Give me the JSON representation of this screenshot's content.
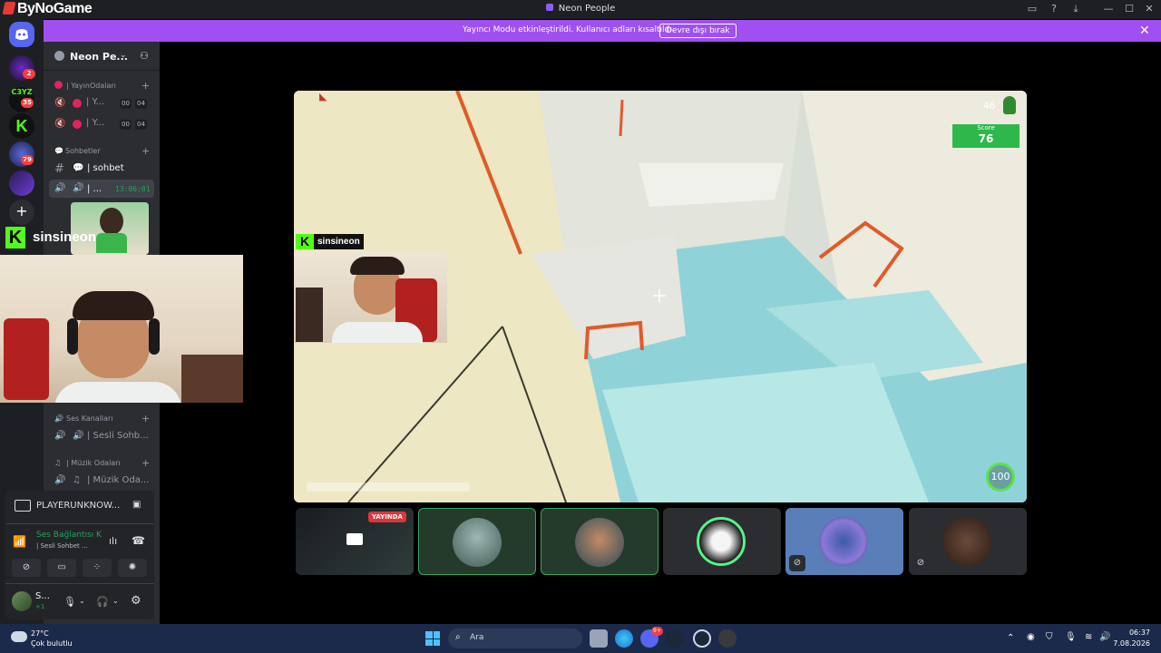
{
  "app": {
    "brand": "ByNoGame",
    "window_title": "Neon People"
  },
  "banner": {
    "text": "Yayıncı Modu etkinleştirildi. Kullanıcı adları kısaltıldı.",
    "button": "Devre dışı bırak"
  },
  "rail": {
    "badges": [
      "2",
      "35",
      "79"
    ],
    "server_tag": "C3YZ"
  },
  "server": {
    "name": "Neon Pe..."
  },
  "channels": {
    "cat1": "| YayınOdaları",
    "stream_rooms": [
      {
        "label": "| Y...",
        "c1": "00",
        "c2": "04"
      },
      {
        "label": "| Y...",
        "c1": "00",
        "c2": "04"
      }
    ],
    "cat2": "Sohbetler",
    "text_channel": "| sohbet",
    "active_voice": "| ...",
    "active_time": "13:06:01",
    "cat3": "Ses Kanalları",
    "voice_channel": "| Sesli Sohb...",
    "cat4": "| Müzik Odaları",
    "music_channel": "| Müzik Oda..."
  },
  "streamer": {
    "name": "sinsineon",
    "k_logo": "K"
  },
  "activity": {
    "game": "PLAYERUNKNOW..."
  },
  "voice_status": {
    "title": "Ses Bağlantısı K",
    "subtitle": "| Sesli Sohbet ..."
  },
  "user": {
    "name": "S...",
    "status": "+1"
  },
  "game_hud": {
    "ammo": "46",
    "score_label": "Score",
    "score": "76",
    "health": "100"
  },
  "tiles": {
    "live_badge": "YAYINDA"
  },
  "taskbar": {
    "weather_temp": "27°C",
    "weather_desc": "Çok bulutlu",
    "search": "Ara",
    "time": "06:37",
    "date": "7.08.2026",
    "discord_badge": "9+"
  },
  "colors": {
    "banner": "#a050f0",
    "kick_green": "#53fc18",
    "live_red": "#da373c",
    "score_green": "#2eb84b"
  }
}
